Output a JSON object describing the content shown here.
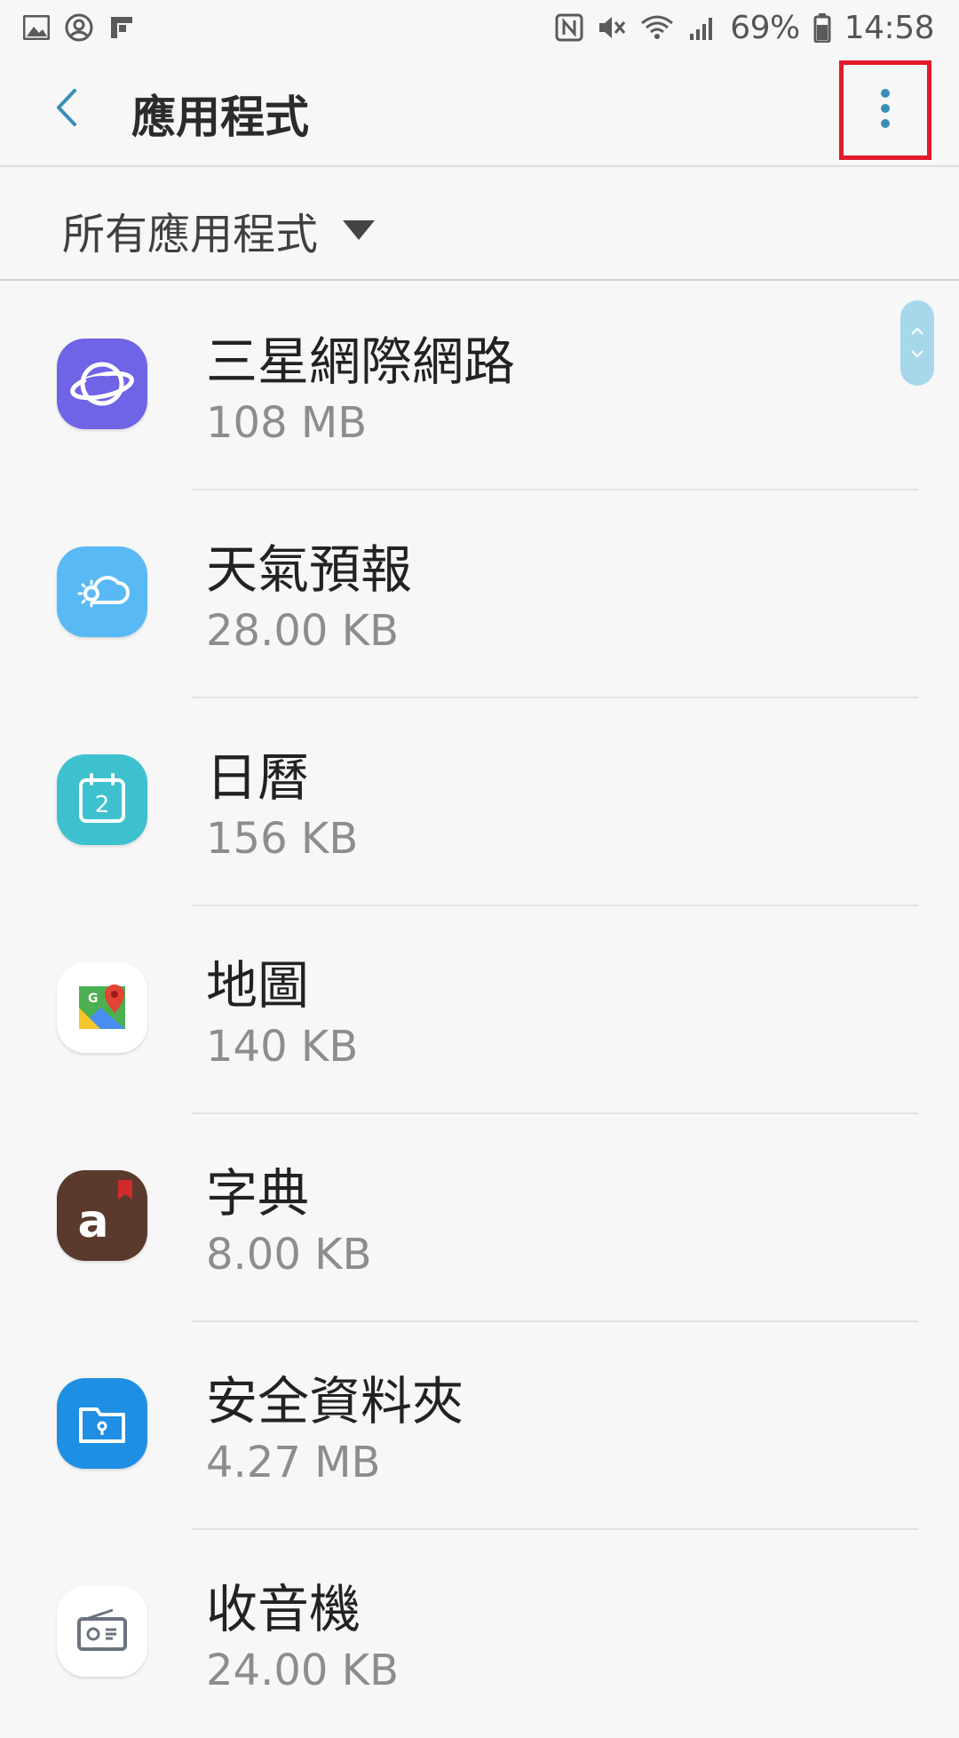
{
  "status_bar": {
    "battery": "69%",
    "time": "14:58",
    "left_icons": [
      "gallery-icon",
      "account-icon",
      "flipboard-icon"
    ],
    "right_icons": [
      "nfc-icon",
      "mute-icon",
      "wifi-icon",
      "signal-icon",
      "battery-icon"
    ]
  },
  "appbar": {
    "title": "應用程式"
  },
  "filter": {
    "label": "所有應用程式"
  },
  "apps": [
    {
      "name": "三星網際網路",
      "size": "108 MB",
      "icon": "samsung-internet-icon",
      "color": "#6f63e6"
    },
    {
      "name": "天氣預報",
      "size": "28.00 KB",
      "icon": "weather-icon",
      "color": "#58b9f5"
    },
    {
      "name": "日曆",
      "size": "156 KB",
      "icon": "calendar-icon",
      "color": "#3ec1cf"
    },
    {
      "name": "地圖",
      "size": "140 KB",
      "icon": "maps-icon",
      "color": "#ffffff"
    },
    {
      "name": "字典",
      "size": "8.00 KB",
      "icon": "dictionary-icon",
      "color": "#5a3a2d"
    },
    {
      "name": "安全資料夾",
      "size": "4.27 MB",
      "icon": "secure-folder-icon",
      "color": "#1f8fe3"
    },
    {
      "name": "收音機",
      "size": "24.00 KB",
      "icon": "radio-icon",
      "color": "#ffffff"
    }
  ],
  "colors": {
    "accent": "#3a8fb7",
    "highlight_box": "#e21b2a"
  }
}
